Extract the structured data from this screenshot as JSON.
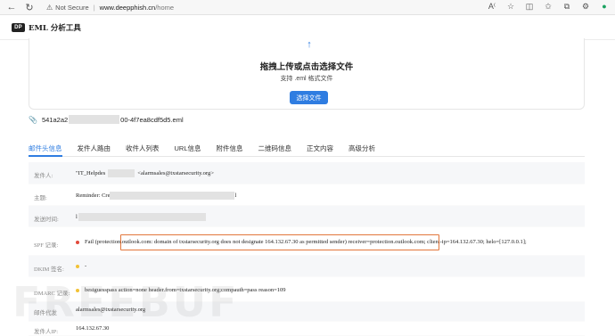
{
  "browser": {
    "warning_icon": "warning-triangle-icon",
    "not_secure": "Not Secure",
    "separator": "|",
    "url_host": "www.deepphish.cn",
    "url_path": "/home"
  },
  "app": {
    "logo_text": "DP",
    "title": "EML 分析工具"
  },
  "upload": {
    "icon": "upload-arrow-icon",
    "title": "拖拽上传或点击选择文件",
    "subtitle": "支持 .eml 格式文件",
    "button_label": "选择文件"
  },
  "file": {
    "icon": "paperclip-icon",
    "name_prefix": "541a2a2",
    "name_suffix": "00-4f7ea8cdf5d5.eml"
  },
  "tabs": [
    "邮件头信息",
    "发件人路由",
    "收件人列表",
    "URL信息",
    "附件信息",
    "二维码信息",
    "正文内容",
    "高级分析"
  ],
  "fields": {
    "sender": {
      "label": "发件人:",
      "value_prefix": "\"IT_Helpdes",
      "value_suffix": "<alarmsales@txstarsecurity.org>"
    },
    "subject": {
      "label": "主题:",
      "value_prefix": "Reminder: Cre",
      "value_suffix": "l"
    },
    "sent_time": {
      "label": "发送时间:",
      "value_prefix": "l"
    },
    "spf": {
      "label": "SPF 记录:",
      "status_color": "#e24a3b",
      "value": "Fail (protection.outlook.com: domain of txstarsecurity.org does not designate 164.132.67.30 as permitted sender) receiver=protection.outlook.com; client-ip=164.132.67.30; helo=[127.0.0.1];"
    },
    "dkim": {
      "label": "DKIM 签名:",
      "status_color": "#f2c236",
      "value": "-"
    },
    "dmarc": {
      "label": "DMARC 记录:",
      "status_color": "#f2c236",
      "value": "bestguesspass action=none header.from=txstarsecurity.org;compauth=pass reason=109"
    },
    "sender_proxy": {
      "label": "邮件代发",
      "value": "alarmsales@txstarsecurity.org"
    },
    "sender_ip": {
      "label": "发件人IP:",
      "value": "164.132.67.30"
    }
  },
  "watermark": "FREEBUF"
}
